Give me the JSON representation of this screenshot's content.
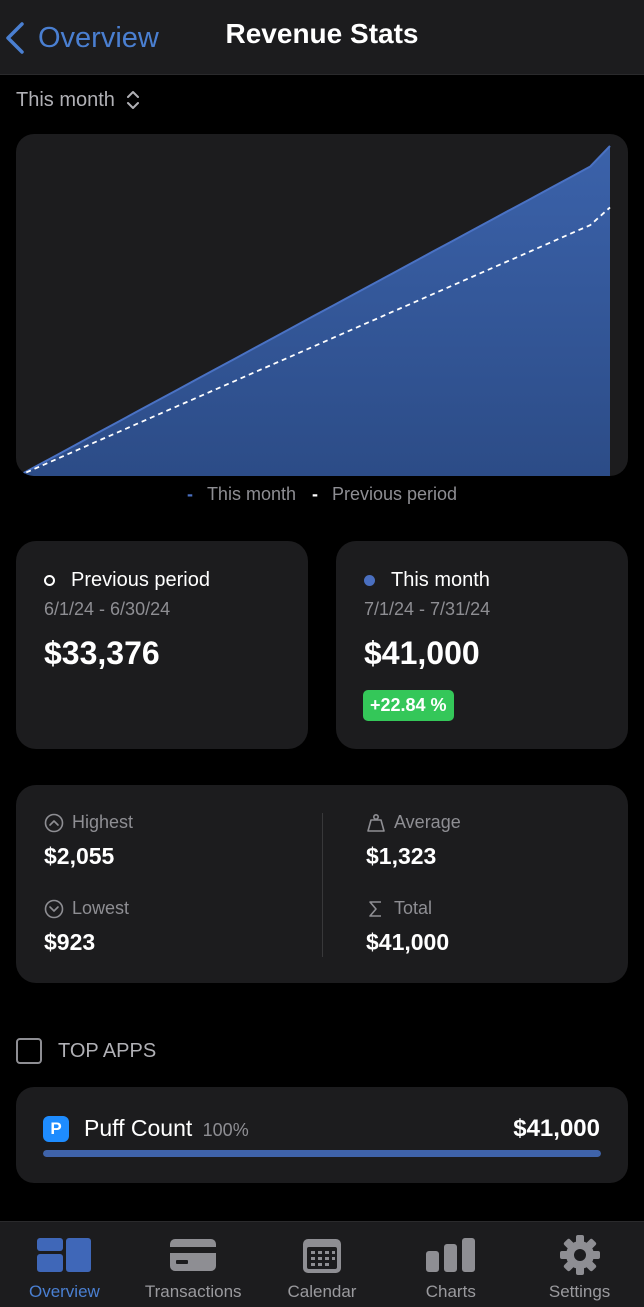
{
  "nav": {
    "back_label": "Overview",
    "title": "Revenue Stats"
  },
  "period_selector": {
    "label": "This month"
  },
  "chart_data": {
    "type": "area",
    "x_range": [
      1,
      31
    ],
    "y_range": [
      0,
      41000
    ],
    "series": [
      {
        "name": "This month",
        "style": "area",
        "color": "#3b5fa3",
        "values": [
          0,
          1320,
          2650,
          3980,
          5300,
          6640,
          7960,
          9290,
          10610,
          11940,
          13260,
          14590,
          15920,
          17240,
          18570,
          19900,
          21220,
          22550,
          23870,
          25200,
          26520,
          27850,
          29170,
          30500,
          31820,
          33150,
          34470,
          35800,
          37120,
          38450,
          41000
        ]
      },
      {
        "name": "Previous period",
        "style": "dashed",
        "color": "#ffffff",
        "values": [
          0,
          1070,
          2150,
          3220,
          4300,
          5370,
          6450,
          7520,
          8600,
          9670,
          10750,
          11820,
          12900,
          13970,
          15050,
          16120,
          17200,
          18270,
          19350,
          20420,
          21500,
          22570,
          23650,
          24720,
          25800,
          26870,
          27950,
          29020,
          30100,
          31170,
          33376
        ]
      }
    ],
    "legend": [
      "This month",
      "Previous period"
    ],
    "legend_position": "bottom-center",
    "grid": false
  },
  "legend": {
    "this_month": "This month",
    "previous": "Previous period"
  },
  "compare": {
    "previous": {
      "title": "Previous period",
      "range": "6/1/24 - 6/30/24",
      "value": "$33,376",
      "dot_color": "#ffffff"
    },
    "current": {
      "title": "This month",
      "range": "7/1/24 - 7/31/24",
      "value": "$41,000",
      "change": "+22.84 %",
      "dot_color": "#4a6fc0",
      "badge_color": "#34c759"
    }
  },
  "stats": {
    "highest": {
      "label": "Highest",
      "value": "$2,055",
      "icon": "chevron-up-circle-icon"
    },
    "lowest": {
      "label": "Lowest",
      "value": "$923",
      "icon": "chevron-down-circle-icon"
    },
    "average": {
      "label": "Average",
      "value": "$1,323",
      "icon": "scale-icon"
    },
    "total": {
      "label": "Total",
      "value": "$41,000",
      "icon": "sigma-icon"
    }
  },
  "top_apps": {
    "title": "TOP APPS",
    "items": [
      {
        "name": "Puff Count",
        "percent": "100%",
        "share": 1.0,
        "value": "$41,000",
        "icon_letter": "P",
        "icon_color": "#1e8cff"
      }
    ]
  },
  "tabs": [
    {
      "label": "Overview",
      "icon": "dashboard-icon",
      "active": true
    },
    {
      "label": "Transactions",
      "icon": "credit-card-icon",
      "active": false
    },
    {
      "label": "Calendar",
      "icon": "calendar-icon",
      "active": false
    },
    {
      "label": "Charts",
      "icon": "bar-chart-icon",
      "active": false
    },
    {
      "label": "Settings",
      "icon": "gear-icon",
      "active": false
    }
  ],
  "colors": {
    "accent": "#4a7fd1",
    "positive": "#34c759",
    "card_bg": "#1c1c1e"
  }
}
